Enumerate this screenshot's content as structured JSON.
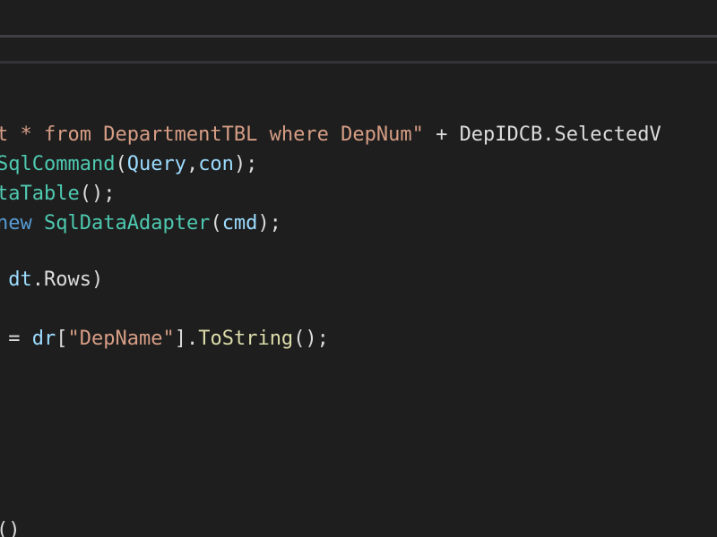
{
  "editor": {
    "theme_colors": {
      "background": "#1e1e1e",
      "keyword": "#569cd6",
      "string": "#d69d85",
      "type": "#4ec9b0",
      "method": "#dcdcaa",
      "variable": "#9cdcfe",
      "plain": "#dcdcdc"
    },
    "lines": [
      {
        "tokens": [
          {
            "kind": "string",
            "text": "t * from DepartmentTBL where DepNum\""
          },
          {
            "kind": "plain",
            "text": " + DepIDCB.SelectedV"
          }
        ]
      },
      {
        "tokens": [
          {
            "kind": "type",
            "text": "SqlCommand"
          },
          {
            "kind": "punct",
            "text": "("
          },
          {
            "kind": "variable",
            "text": "Query"
          },
          {
            "kind": "punct",
            "text": ","
          },
          {
            "kind": "variable",
            "text": "con"
          },
          {
            "kind": "punct",
            "text": ");"
          }
        ]
      },
      {
        "tokens": [
          {
            "kind": "type",
            "text": "taTable"
          },
          {
            "kind": "punct",
            "text": "();"
          }
        ]
      },
      {
        "tokens": [
          {
            "kind": "keyword",
            "text": "new"
          },
          {
            "kind": "plain",
            "text": " "
          },
          {
            "kind": "type",
            "text": "SqlDataAdapter"
          },
          {
            "kind": "punct",
            "text": "("
          },
          {
            "kind": "variable",
            "text": "cmd"
          },
          {
            "kind": "punct",
            "text": ");"
          }
        ]
      },
      {
        "tokens": [
          {
            "kind": "plain",
            "text": " "
          },
          {
            "kind": "variable",
            "text": "dt"
          },
          {
            "kind": "plain",
            "text": ".Rows)"
          }
        ]
      },
      {
        "tokens": [
          {
            "kind": "plain",
            "text": " = "
          },
          {
            "kind": "variable",
            "text": "dr"
          },
          {
            "kind": "punct",
            "text": "["
          },
          {
            "kind": "string",
            "text": "\"DepName\""
          },
          {
            "kind": "punct",
            "text": "]."
          },
          {
            "kind": "method",
            "text": "ToString"
          },
          {
            "kind": "punct",
            "text": "();"
          }
        ]
      },
      {
        "tokens": [
          {
            "kind": "punct",
            "text": "()"
          }
        ]
      }
    ]
  }
}
